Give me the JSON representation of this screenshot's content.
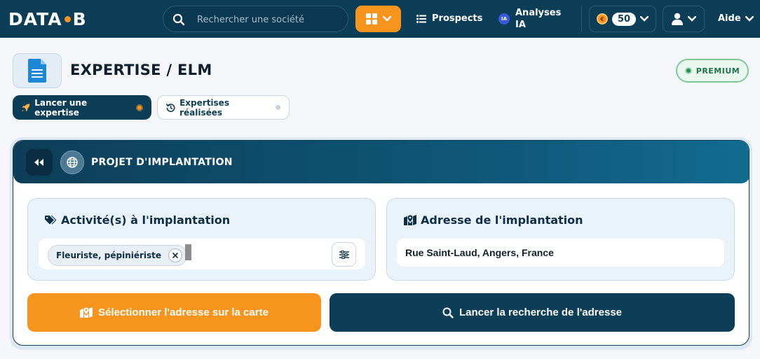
{
  "nav": {
    "logo_left": "DATA",
    "logo_right": "B",
    "search_placeholder": "Rechercher une société",
    "prospects_label": "Prospects",
    "ia_badge": "IA",
    "ia_label": "Analyses IA",
    "credits_count": "50",
    "coin_symbol": "€",
    "help_label": "Aide"
  },
  "header": {
    "title": "EXPERTISE / ELM",
    "premium_label": "PREMIUM"
  },
  "tabs": [
    {
      "label": "Lancer une expertise",
      "active": true
    },
    {
      "label": "Expertises réalisées",
      "active": false
    }
  ],
  "card": {
    "title": "PROJET D'IMPLANTATION",
    "activity_label": "Activité(s) à l'implantation",
    "activity_chip": "Fleuriste, pépiniériste",
    "address_label": "Adresse de l'implantation",
    "address_value": "Rue Saint-Laud, Angers, France",
    "btn_map": "Sélectionner l'adresse sur la carte",
    "btn_search": "Lancer la recherche de l'adresse"
  },
  "colors": {
    "navy": "#0d3e58",
    "orange": "#f7941d",
    "premium_green": "#20734a"
  }
}
